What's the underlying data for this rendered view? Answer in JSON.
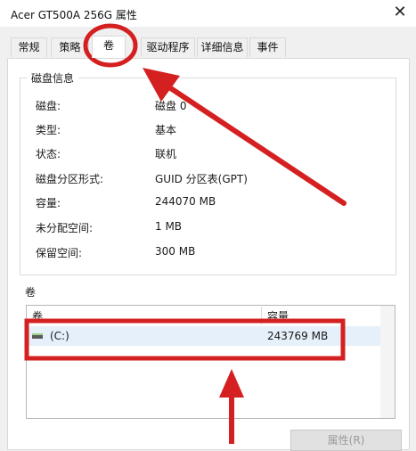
{
  "window": {
    "title": "Acer GT500A 256G 属性",
    "close_glyph": "✕"
  },
  "tabs": [
    {
      "label": "常规"
    },
    {
      "label": "策略"
    },
    {
      "label": "卷",
      "selected": true
    },
    {
      "label": "驱动程序"
    },
    {
      "label": "详细信息"
    },
    {
      "label": "事件"
    }
  ],
  "disk_info": {
    "title": "磁盘信息",
    "rows": [
      {
        "label": "磁盘:",
        "value": "磁盘 0"
      },
      {
        "label": "类型:",
        "value": "基本"
      },
      {
        "label": "状态:",
        "value": "联机"
      },
      {
        "label": "磁盘分区形式:",
        "value": "GUID 分区表(GPT)"
      },
      {
        "label": "容量:",
        "value": "244070 MB"
      },
      {
        "label": "未分配空间:",
        "value": "1 MB"
      },
      {
        "label": "保留空间:",
        "value": "300 MB"
      }
    ]
  },
  "volumes": {
    "title": "卷",
    "columns": [
      "卷",
      "容量"
    ],
    "rows": [
      {
        "volume": "(C:)",
        "capacity": "243769 MB",
        "icon": "drive-icon"
      }
    ]
  },
  "buttons": {
    "properties": "属性(R)"
  },
  "annotations": {
    "color": "#d42020"
  }
}
